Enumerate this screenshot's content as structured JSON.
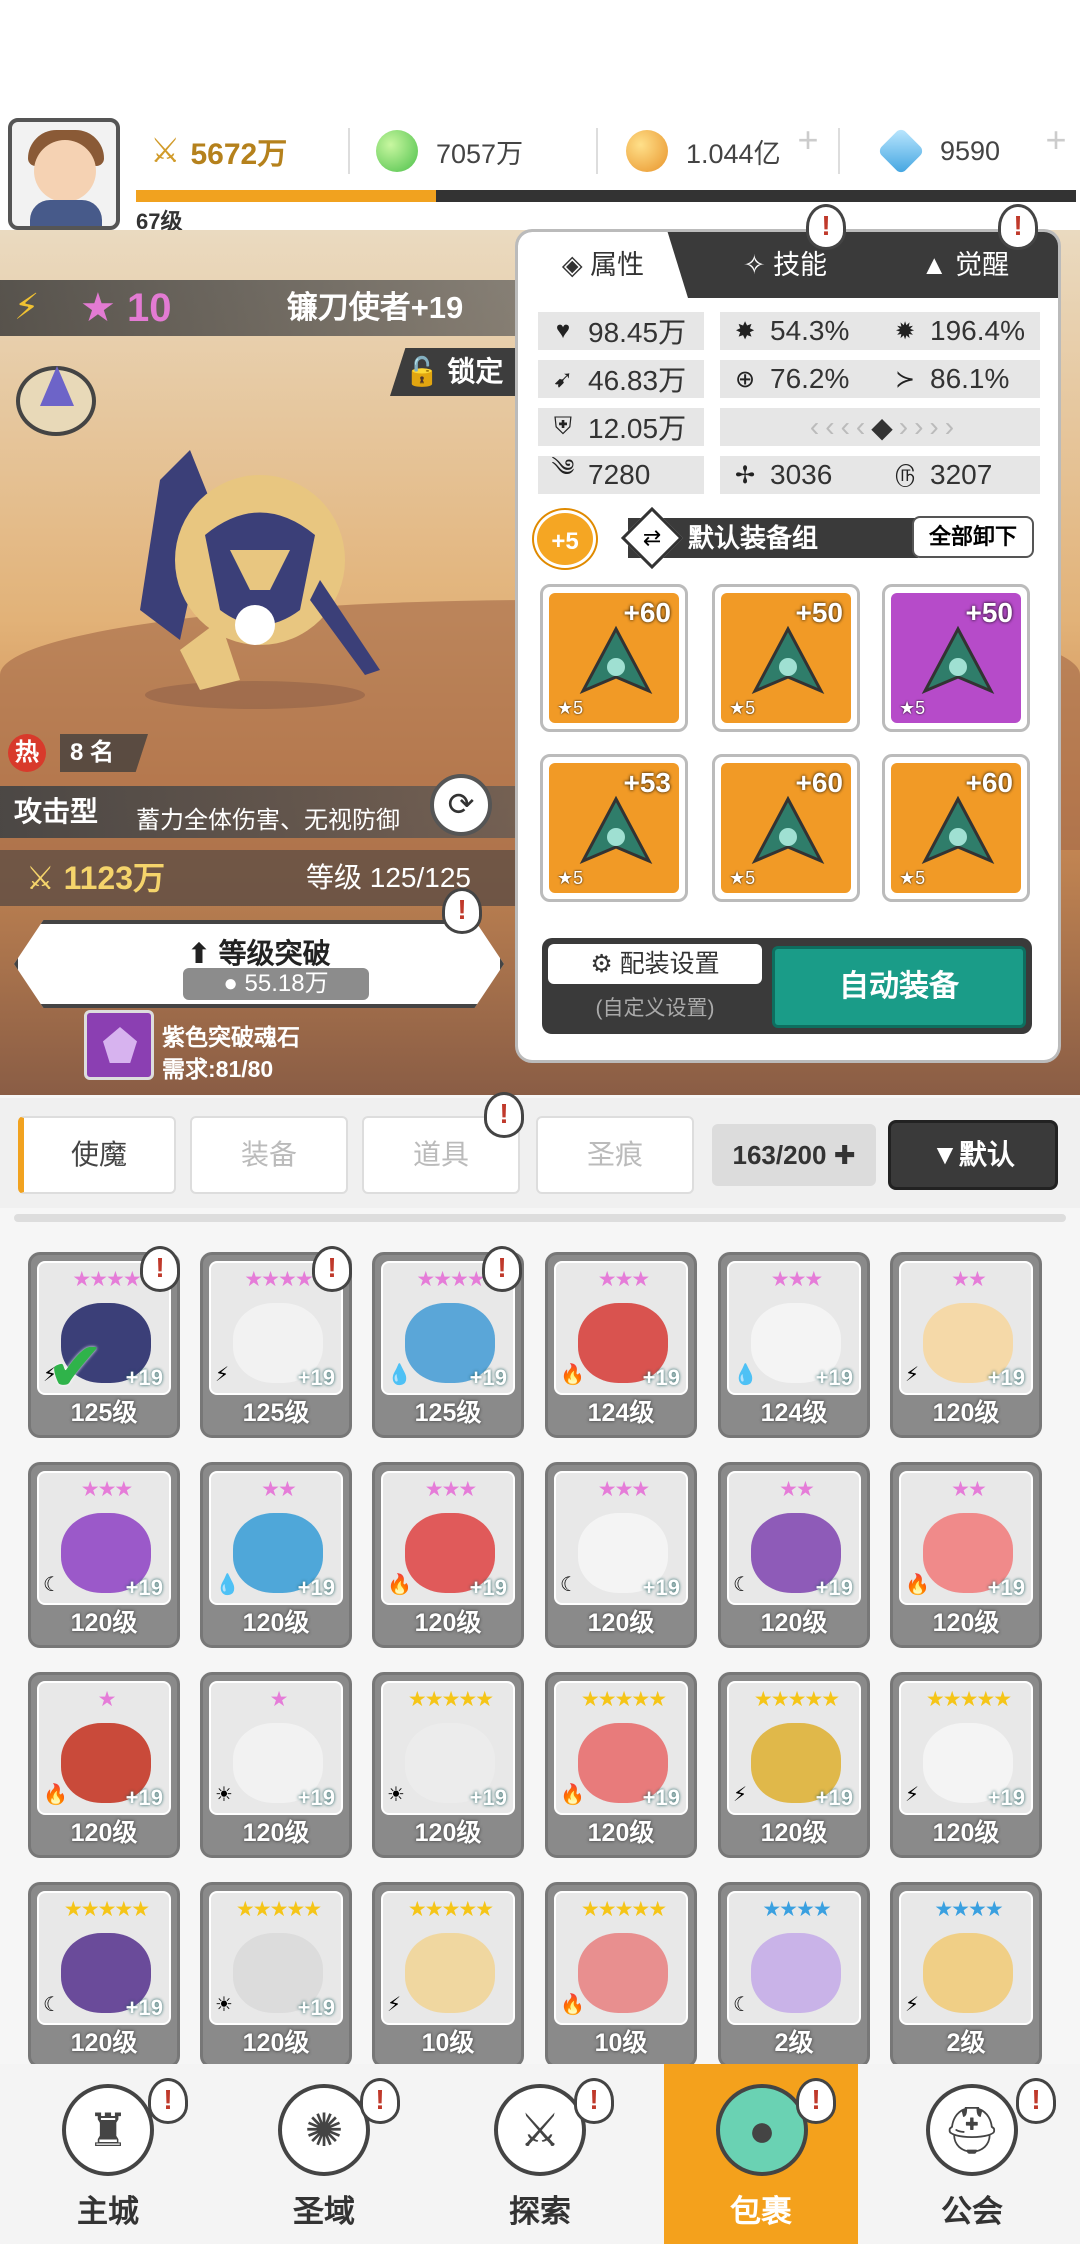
{
  "topbar": {
    "power": "5672万",
    "green_currency": "7057万",
    "gold_currency": "1.044亿",
    "diamond_currency": "9590",
    "player_level": "67级"
  },
  "hero": {
    "stars": "10",
    "name": "镰刀使者+19",
    "lock_label": "锁定",
    "hot_rank": "8 名",
    "role_type": "攻击型",
    "role_desc": "蓄力全体伤害、无视防御",
    "power": "1123万",
    "level": "等级 125/125",
    "break_label": "等级突破",
    "break_cost": "55.18万",
    "stone_name": "紫色突破魂石",
    "stone_req": "需求:81/80"
  },
  "panel": {
    "tabs": [
      "属性",
      "技能",
      "觉醒"
    ],
    "stats": {
      "hp": "98.45万",
      "crit": "54.3%",
      "crit_dmg": "196.4%",
      "atk": "46.83万",
      "hit": "76.2%",
      "dodge": "86.1%",
      "def": "12.05万",
      "s1": "7280",
      "s2": "3036",
      "s3": "3207"
    },
    "equip_badge": "+5",
    "equip_set": "默认装备组",
    "unequip_label": "全部卸下",
    "equips": [
      {
        "level": "+60",
        "star": "★5",
        "color": "#f19a26"
      },
      {
        "level": "+50",
        "star": "★5",
        "color": "#f19a26"
      },
      {
        "level": "+50",
        "star": "★5",
        "color": "#b64bc9"
      },
      {
        "level": "+53",
        "star": "★5",
        "color": "#f19a26"
      },
      {
        "level": "+60",
        "star": "★5",
        "color": "#f19a26"
      },
      {
        "level": "+60",
        "star": "★5",
        "color": "#f19a26"
      }
    ],
    "config_label": "配装设置",
    "config_sub": "(自定义设置)",
    "auto_label": "自动装备"
  },
  "categories": [
    "使魔",
    "装备",
    "道具",
    "圣痕"
  ],
  "count": "163/200",
  "sort_label": "▼默认",
  "heroes": [
    {
      "lvl": "125级",
      "plus": "+19",
      "stars": "★★★★",
      "star_color": "#e57cd8",
      "elem": "⚡",
      "color": "#3b3f78"
    },
    {
      "lvl": "125级",
      "plus": "+19",
      "stars": "★★★★",
      "star_color": "#e57cd8",
      "elem": "⚡",
      "color": "#f2f2f2"
    },
    {
      "lvl": "125级",
      "plus": "+19",
      "stars": "★★★★",
      "star_color": "#e57cd8",
      "elem": "💧",
      "color": "#5aa6d8"
    },
    {
      "lvl": "124级",
      "plus": "+19",
      "stars": "★★★",
      "star_color": "#e57cd8",
      "elem": "🔥",
      "color": "#d9534f"
    },
    {
      "lvl": "124级",
      "plus": "+19",
      "stars": "★★★",
      "star_color": "#e57cd8",
      "elem": "💧",
      "color": "#f4f4f4"
    },
    {
      "lvl": "120级",
      "plus": "+19",
      "stars": "★★",
      "star_color": "#e57cd8",
      "elem": "⚡",
      "color": "#f5d9a8"
    },
    {
      "lvl": "120级",
      "plus": "+19",
      "stars": "★★★",
      "star_color": "#e57cd8",
      "elem": "☾",
      "color": "#9b59c9"
    },
    {
      "lvl": "120级",
      "plus": "+19",
      "stars": "★★",
      "star_color": "#e57cd8",
      "elem": "💧",
      "color": "#4fa7d9"
    },
    {
      "lvl": "120级",
      "plus": "+19",
      "stars": "★★★",
      "star_color": "#e57cd8",
      "elem": "🔥",
      "color": "#e05a5a"
    },
    {
      "lvl": "120级",
      "plus": "+19",
      "stars": "★★★",
      "star_color": "#e57cd8",
      "elem": "☾",
      "color": "#f4f4f4"
    },
    {
      "lvl": "120级",
      "plus": "+19",
      "stars": "★★",
      "star_color": "#e57cd8",
      "elem": "☾",
      "color": "#8e5bb8"
    },
    {
      "lvl": "120级",
      "plus": "+19",
      "stars": "★★",
      "star_color": "#e57cd8",
      "elem": "🔥",
      "color": "#f08a8a"
    },
    {
      "lvl": "120级",
      "plus": "+19",
      "stars": "★",
      "star_color": "#e57cd8",
      "elem": "🔥",
      "color": "#c94a3a"
    },
    {
      "lvl": "120级",
      "plus": "+19",
      "stars": "★",
      "star_color": "#e57cd8",
      "elem": "☀",
      "color": "#f2f2f2"
    },
    {
      "lvl": "120级",
      "plus": "+19",
      "stars": "★★★★★",
      "star_color": "#f5c518",
      "elem": "☀",
      "color": "#ececec"
    },
    {
      "lvl": "120级",
      "plus": "+19",
      "stars": "★★★★★",
      "star_color": "#f5c518",
      "elem": "🔥",
      "color": "#e87b7b"
    },
    {
      "lvl": "120级",
      "plus": "+19",
      "stars": "★★★★★",
      "star_color": "#f5c518",
      "elem": "⚡",
      "color": "#e0b84a"
    },
    {
      "lvl": "120级",
      "plus": "+19",
      "stars": "★★★★★",
      "star_color": "#f5c518",
      "elem": "⚡",
      "color": "#f4f4f4"
    },
    {
      "lvl": "120级",
      "plus": "+19",
      "stars": "★★★★★",
      "star_color": "#f5c518",
      "elem": "☾",
      "color": "#6a4b9a"
    },
    {
      "lvl": "120级",
      "plus": "+19",
      "stars": "★★★★★",
      "star_color": "#f5c518",
      "elem": "☀",
      "color": "#dcdcdc"
    },
    {
      "lvl": "10级",
      "plus": "",
      "stars": "★★★★★",
      "star_color": "#f5c518",
      "elem": "⚡",
      "color": "#f0d7a0"
    },
    {
      "lvl": "10级",
      "plus": "",
      "stars": "★★★★★",
      "star_color": "#f5c518",
      "elem": "🔥",
      "color": "#e88f8f"
    },
    {
      "lvl": "2级",
      "plus": "",
      "stars": "★★★★",
      "star_color": "#3aa0e0",
      "elem": "☾",
      "color": "#c9b3e8"
    },
    {
      "lvl": "2级",
      "plus": "",
      "stars": "★★★★",
      "star_color": "#3aa0e0",
      "elem": "⚡",
      "color": "#f0cf86"
    }
  ],
  "nav": [
    "主城",
    "圣域",
    "探索",
    "包裹",
    "公会"
  ],
  "colors": {
    "accent": "#f4a11c",
    "teal": "#1a9c88",
    "dark": "#3a3a3a"
  }
}
